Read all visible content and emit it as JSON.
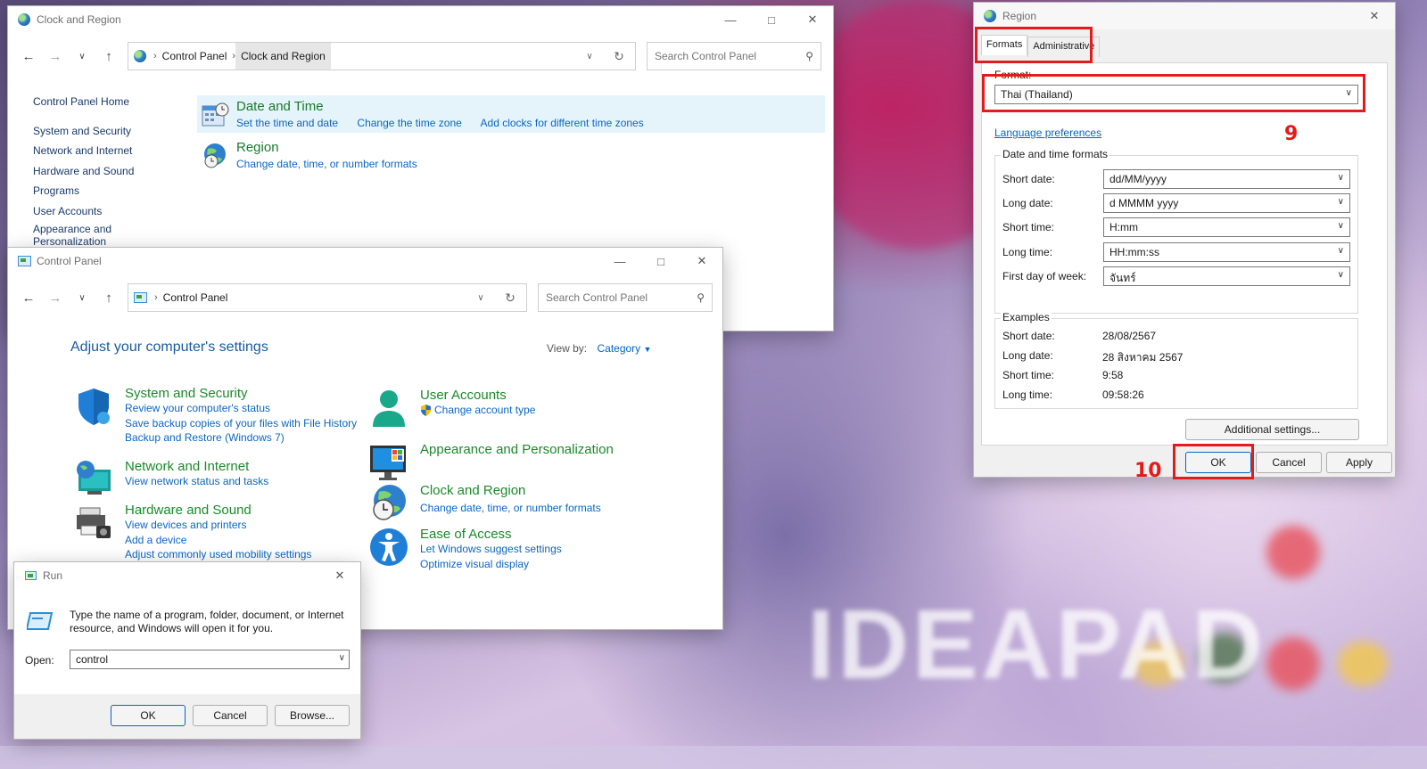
{
  "colors": {
    "accent_link": "#0066cc",
    "category_green": "#1a8a2a",
    "annotation_red": "#e21b1b"
  },
  "clock_window": {
    "title": "Clock and Region",
    "breadcrumb": [
      "Control Panel",
      "Clock and Region"
    ],
    "search_placeholder": "Search Control Panel",
    "sidebar": [
      "Control Panel Home",
      "System and Security",
      "Network and Internet",
      "Hardware and Sound",
      "Programs",
      "User Accounts",
      "Appearance and Personalization"
    ],
    "categories": [
      {
        "title": "Date and Time",
        "links": [
          "Set the time and date",
          "Change the time zone",
          "Add clocks for different time zones"
        ]
      },
      {
        "title": "Region",
        "links": [
          "Change date, time, or number formats"
        ]
      }
    ]
  },
  "cp_window": {
    "title": "Control Panel",
    "breadcrumb": [
      "Control Panel"
    ],
    "search_placeholder": "Search Control Panel",
    "heading": "Adjust your computer's settings",
    "view_by_label": "View by:",
    "view_by_value": "Category",
    "left_categories": [
      {
        "title": "System and Security",
        "links": [
          "Review your computer's status",
          "Save backup copies of your files with File History",
          "Backup and Restore (Windows 7)"
        ]
      },
      {
        "title": "Network and Internet",
        "links": [
          "View network status and tasks"
        ]
      },
      {
        "title": "Hardware and Sound",
        "links": [
          "View devices and printers",
          "Add a device",
          "Adjust commonly used mobility settings"
        ]
      }
    ],
    "right_categories": [
      {
        "title": "User Accounts",
        "links": [
          "Change account type"
        ]
      },
      {
        "title": "Appearance and Personalization",
        "links": []
      },
      {
        "title": "Clock and Region",
        "links": [
          "Change date, time, or number formats"
        ]
      },
      {
        "title": "Ease of Access",
        "links": [
          "Let Windows suggest settings",
          "Optimize visual display"
        ]
      }
    ]
  },
  "run_dialog": {
    "title": "Run",
    "description": "Type the name of a program, folder, document, or Internet resource, and Windows will open it for you.",
    "open_label": "Open:",
    "open_value": "control",
    "ok": "OK",
    "cancel": "Cancel",
    "browse": "Browse..."
  },
  "region_dialog": {
    "title": "Region",
    "tabs": [
      "Formats",
      "Administrative"
    ],
    "format_label": "Format:",
    "format_value": "Thai (Thailand)",
    "language_link": "Language preferences",
    "dt_group_label": "Date and time formats",
    "formats": [
      {
        "label": "Short date:",
        "value": "dd/MM/yyyy"
      },
      {
        "label": "Long date:",
        "value": "d MMMM yyyy"
      },
      {
        "label": "Short time:",
        "value": "H:mm"
      },
      {
        "label": "Long time:",
        "value": "HH:mm:ss"
      },
      {
        "label": "First day of week:",
        "value": "จันทร์"
      }
    ],
    "examples_label": "Examples",
    "examples": [
      {
        "label": "Short date:",
        "value": "28/08/2567"
      },
      {
        "label": "Long date:",
        "value": "28 สิงหาคม 2567"
      },
      {
        "label": "Short time:",
        "value": "9:58"
      },
      {
        "label": "Long time:",
        "value": "09:58:26"
      }
    ],
    "additional_settings": "Additional settings...",
    "ok": "OK",
    "cancel": "Cancel",
    "apply": "Apply"
  },
  "annotations": {
    "step_9": "9",
    "step_10": "10"
  }
}
